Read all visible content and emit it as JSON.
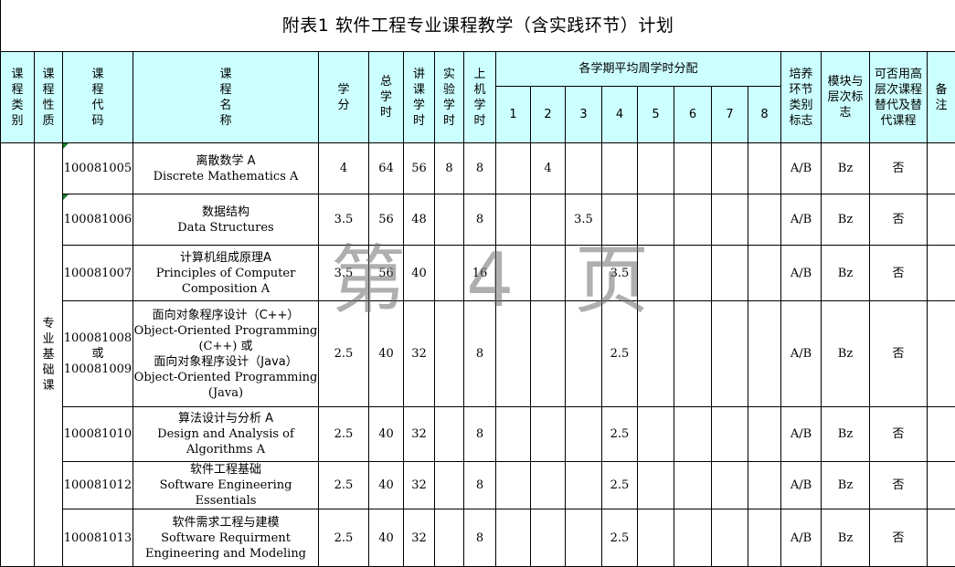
{
  "title": "附表1  软件工程专业课程教学（含实践环节）计划",
  "watermark": "第 4 页",
  "headers": {
    "category": "课程类别",
    "nature": "课程性质",
    "code": "课程代码",
    "name": "课程名称",
    "credit": "学分",
    "total_hours": "总学时",
    "lecture_hours": "讲课学时",
    "lab_hours": "实验学时",
    "computer_hours": "上机学时",
    "semester_group": "各学期平均周学时分配",
    "semesters": [
      "1",
      "2",
      "3",
      "4",
      "5",
      "6",
      "7",
      "8"
    ],
    "training_flag": "培养环节类别标志",
    "module_level": "模块与层次标志",
    "substitutable": "可否用高层次课程替代及替代课程",
    "remarks": "备注"
  },
  "nature_merged": "专业基础课",
  "rows": [
    {
      "code": "100081005",
      "name_cn": "离散数学 A",
      "name_en": "Discrete Mathematics A",
      "credit": "4",
      "total": "64",
      "lecture": "56",
      "lab": "8",
      "computer": "8",
      "semesters": [
        "",
        "4",
        "",
        "",
        "",
        "",
        "",
        ""
      ],
      "flag": "A/B",
      "module": "Bz",
      "sub": "否",
      "remark": ""
    },
    {
      "code": "100081006",
      "name_cn": "数据结构",
      "name_en": "Data Structures",
      "credit": "3.5",
      "total": "56",
      "lecture": "48",
      "lab": "",
      "computer": "8",
      "semesters": [
        "",
        "",
        "3.5",
        "",
        "",
        "",
        "",
        ""
      ],
      "flag": "A/B",
      "module": "Bz",
      "sub": "否",
      "remark": ""
    },
    {
      "code": "100081007",
      "name_cn": "计算机组成原理A",
      "name_en": "Principles of Computer Composition A",
      "credit": "3.5",
      "total": "56",
      "lecture": "40",
      "lab": "",
      "computer": "16",
      "semesters": [
        "",
        "",
        "",
        "3.5",
        "",
        "",
        "",
        ""
      ],
      "flag": "A/B",
      "module": "Bz",
      "sub": "否",
      "remark": ""
    },
    {
      "code": "100081008 或 100081009",
      "code_lines": [
        "100081008",
        "或",
        "100081009"
      ],
      "name_lines": [
        "面向对象程序设计（C++）",
        "Object-Oriented Programming (C++) 或",
        "面向对象程序设计（Java）",
        "Object-Oriented Programming (Java)"
      ],
      "credit": "2.5",
      "total": "40",
      "lecture": "32",
      "lab": "",
      "computer": "8",
      "semesters": [
        "",
        "",
        "",
        "2.5",
        "",
        "",
        "",
        ""
      ],
      "flag": "A/B",
      "module": "Bz",
      "sub": "否",
      "remark": ""
    },
    {
      "code": "100081010",
      "name_cn": "算法设计与分析 A",
      "name_en": "Design and Analysis of Algorithms A",
      "credit": "2.5",
      "total": "40",
      "lecture": "32",
      "lab": "",
      "computer": "8",
      "semesters": [
        "",
        "",
        "",
        "2.5",
        "",
        "",
        "",
        ""
      ],
      "flag": "A/B",
      "module": "Bz",
      "sub": "否",
      "remark": ""
    },
    {
      "code": "100081012",
      "name_cn": "软件工程基础",
      "name_en": "Software Engineering Essentials",
      "credit": "2.5",
      "total": "40",
      "lecture": "32",
      "lab": "",
      "computer": "8",
      "semesters": [
        "",
        "",
        "",
        "2.5",
        "",
        "",
        "",
        ""
      ],
      "flag": "A/B",
      "module": "Bz",
      "sub": "否",
      "remark": ""
    },
    {
      "code": "100081013",
      "name_cn": "软件需求工程与建模",
      "name_en": "Software Requirment Engineering and Modeling",
      "credit": "2.5",
      "total": "40",
      "lecture": "32",
      "lab": "",
      "computer": "8",
      "semesters": [
        "",
        "",
        "",
        "2.5",
        "",
        "",
        "",
        ""
      ],
      "flag": "A/B",
      "module": "Bz",
      "sub": "否",
      "remark": ""
    }
  ]
}
